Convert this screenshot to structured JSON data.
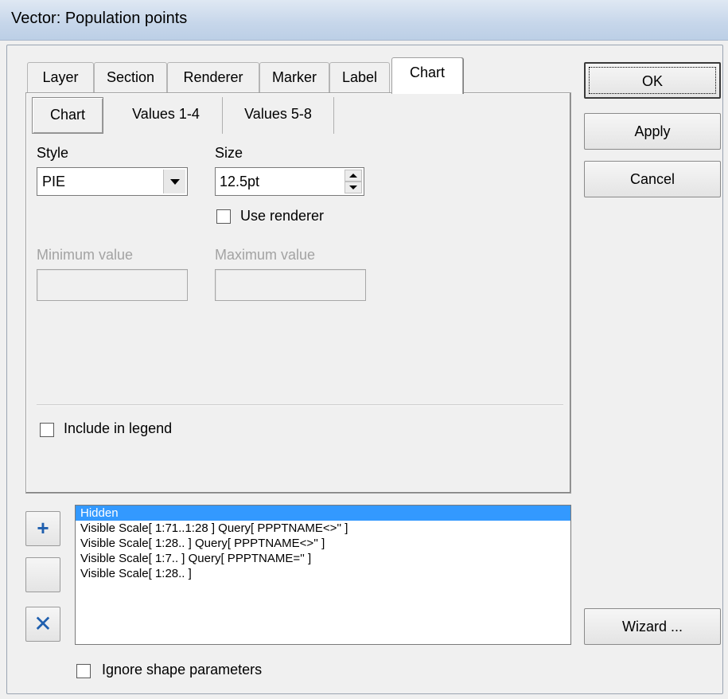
{
  "window": {
    "title": "Vector: Population points"
  },
  "tabs": [
    {
      "label": "Layer",
      "active": false
    },
    {
      "label": "Section",
      "active": false
    },
    {
      "label": "Renderer",
      "active": false
    },
    {
      "label": "Marker",
      "active": false
    },
    {
      "label": "Label",
      "active": false
    },
    {
      "label": "Chart",
      "active": true
    }
  ],
  "subtabs": [
    {
      "label": "Chart",
      "active": true
    },
    {
      "label": "Values 1-4",
      "active": false
    },
    {
      "label": "Values 5-8",
      "active": false
    }
  ],
  "chart": {
    "style_label": "Style",
    "style_value": "PIE",
    "size_label": "Size",
    "size_value": "12.5pt",
    "use_renderer_label": "Use renderer",
    "use_renderer_checked": false,
    "minimum_label": "Minimum value",
    "minimum_value": "",
    "maximum_label": "Maximum value",
    "maximum_value": "",
    "include_legend_label": "Include in legend",
    "include_legend_checked": false
  },
  "buttons": {
    "ok": "OK",
    "apply": "Apply",
    "cancel": "Cancel",
    "wizard": "Wizard ..."
  },
  "side_buttons": {
    "add_glyph": "+",
    "delete_glyph": "✕"
  },
  "sections_list": [
    {
      "text": "Hidden",
      "selected": true
    },
    {
      "text": "Visible Scale[ 1:71..1:28 ] Query[ PPPTNAME<>'' ]",
      "selected": false
    },
    {
      "text": "Visible Scale[ 1:28.. ] Query[ PPPTNAME<>'' ]",
      "selected": false
    },
    {
      "text": "Visible Scale[ 1:7.. ] Query[ PPPTNAME='' ]",
      "selected": false
    },
    {
      "text": "Visible Scale[ 1:28.. ]",
      "selected": false
    }
  ],
  "ignore_shape_label": "Ignore shape parameters",
  "ignore_shape_checked": false,
  "colors": {
    "selection": "#3399ff",
    "add_icon": "#1f5fae",
    "delete_icon": "#1f5fae"
  }
}
